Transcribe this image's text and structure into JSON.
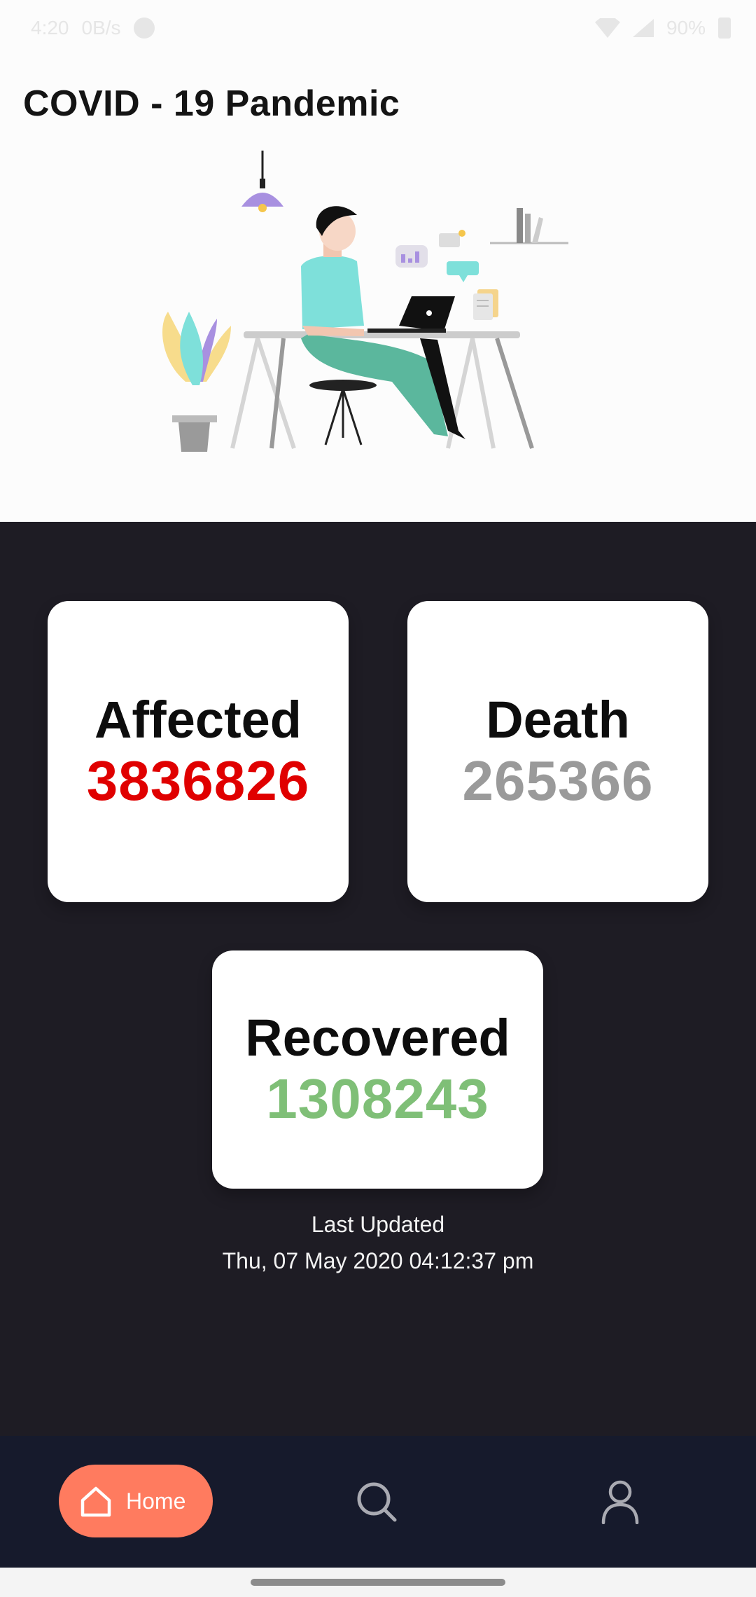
{
  "status_bar": {
    "time": "4:20",
    "speed": "0B/s",
    "battery": "90%"
  },
  "header": {
    "title": "COVID - 19 Pandemic"
  },
  "stats": {
    "affected": {
      "label": "Affected",
      "value": "3836826",
      "color": "#e00000"
    },
    "death": {
      "label": "Death",
      "value": "265366",
      "color": "#9a9a9a"
    },
    "recovered": {
      "label": "Recovered",
      "value": "1308243",
      "color": "#7fbf77"
    }
  },
  "last_updated": {
    "label": "Last Updated",
    "value": "Thu, 07 May 2020 04:12:37 pm"
  },
  "nav": {
    "home_label": "Home",
    "active_color": "#ff7b5f",
    "icons": [
      "home-icon",
      "search-icon",
      "profile-icon"
    ]
  }
}
